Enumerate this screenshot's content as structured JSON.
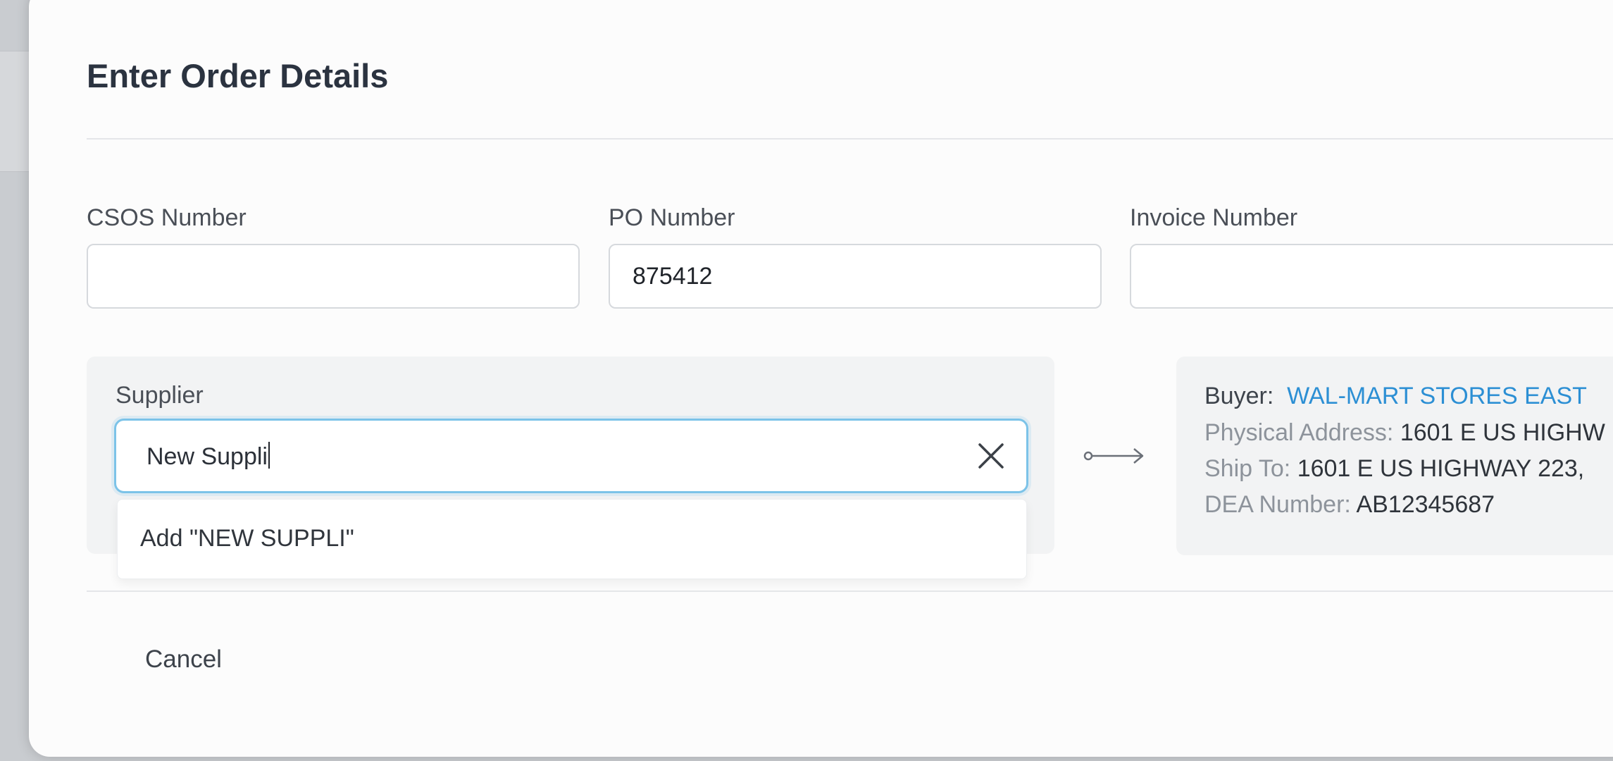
{
  "modal": {
    "title": "Enter Order Details"
  },
  "fields": {
    "csos": {
      "label": "CSOS Number",
      "value": ""
    },
    "po": {
      "label": "PO Number",
      "value": "875412"
    },
    "invoice": {
      "label": "Invoice Number",
      "value": ""
    }
  },
  "supplier": {
    "label": "Supplier",
    "value": "New Suppli",
    "clear_icon": "close-icon",
    "dropdown_option": "Add \"NEW SUPPLI\""
  },
  "link_icon": "long-arrow-right-icon",
  "buyer": {
    "buyer_key": "Buyer:",
    "buyer_name": "WAL-MART STORES EAST",
    "physical_key": "Physical Address:",
    "physical_value": "1601 E US HIGHW",
    "ship_key": "Ship To:",
    "ship_value": "1601 E US HIGHWAY 223,",
    "dea_key": "DEA Number:",
    "dea_value": "AB12345687"
  },
  "footer": {
    "cancel_label": "Cancel"
  },
  "colors": {
    "accent_focus": "#7cc3e8",
    "link": "#2c8fd4"
  }
}
